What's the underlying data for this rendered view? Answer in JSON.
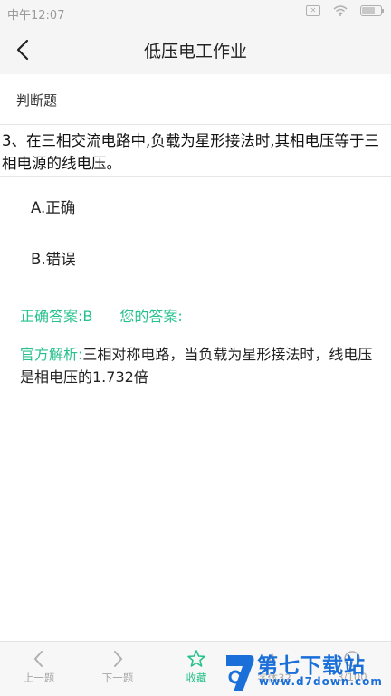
{
  "status": {
    "time": "中午12:07"
  },
  "header": {
    "title": "低压电工作业"
  },
  "question": {
    "type": "判断题",
    "text": "3、在三相交流电路中,负载为星形接法时,其相电压等于三相电源的线电压。",
    "options": [
      "A.正确",
      "B.错误"
    ]
  },
  "answer": {
    "correct_label": "正确答案:",
    "correct_value": "B",
    "yours_label": "您的答案:"
  },
  "analysis": {
    "label": "官方解析:",
    "text": "三相对称电路，当负载为星形接法时，线电压是相电压的1.732倍"
  },
  "bottombar": {
    "prev": "上一题",
    "next": "下一题",
    "fav": "收藏",
    "font": "字体32",
    "progress": "3/100"
  },
  "watermark": {
    "brand": "第七下载站",
    "url": "www.d7down.com"
  },
  "colors": {
    "accent": "#27c28c",
    "watermark": "#1a6fd8"
  }
}
